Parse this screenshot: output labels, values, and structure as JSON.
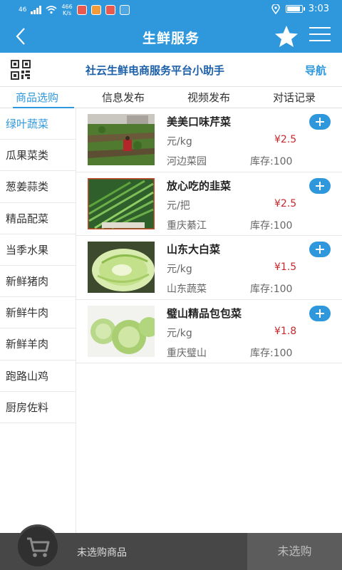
{
  "status_bar": {
    "network": "46",
    "speed_value": "466",
    "speed_unit": "K/s",
    "time": "3:03"
  },
  "header": {
    "back_icon": "chevron-left-icon",
    "title": "生鲜服务",
    "star_icon": "star-icon",
    "menu_icon": "menu-icon"
  },
  "assistant": {
    "qr_icon": "qr-code-icon",
    "title": "社云生鲜电商服务平台小助手",
    "nav_label": "导航"
  },
  "tabs": [
    {
      "label": "商品选购",
      "active": true
    },
    {
      "label": "信息发布",
      "active": false
    },
    {
      "label": "视频发布",
      "active": false
    },
    {
      "label": "对话记录",
      "active": false
    }
  ],
  "categories": [
    {
      "label": "绿叶蔬菜",
      "active": true
    },
    {
      "label": "瓜果菜类",
      "active": false
    },
    {
      "label": "葱姜蒜类",
      "active": false
    },
    {
      "label": "精品配菜",
      "active": false
    },
    {
      "label": "当季水果",
      "active": false
    },
    {
      "label": "新鲜猪肉",
      "active": false
    },
    {
      "label": "新鲜牛肉",
      "active": false
    },
    {
      "label": "新鲜羊肉",
      "active": false
    },
    {
      "label": "跑路山鸡",
      "active": false
    },
    {
      "label": "厨房佐料",
      "active": false
    }
  ],
  "products": [
    {
      "name": "美美口味芹菜",
      "unit": "元/kg",
      "price": "¥2.5",
      "origin": "河边菜园",
      "stock": "库存:100"
    },
    {
      "name": "放心吃的韭菜",
      "unit": "元/把",
      "price": "¥2.5",
      "origin": "重庆綦江",
      "stock": "库存:100"
    },
    {
      "name": "山东大白菜",
      "unit": "元/kg",
      "price": "¥1.5",
      "origin": "山东蔬菜",
      "stock": "库存:100"
    },
    {
      "name": "璧山精品包包菜",
      "unit": "元/kg",
      "price": "¥1.8",
      "origin": "重庆璧山",
      "stock": "库存:100"
    }
  ],
  "cart": {
    "cart_icon": "shopping-cart-icon",
    "empty_text": "未选购商品",
    "checkout_label": "未选购"
  },
  "colors": {
    "primary": "#2f98dc",
    "price": "#c8282b",
    "cart_bar": "#474747"
  }
}
